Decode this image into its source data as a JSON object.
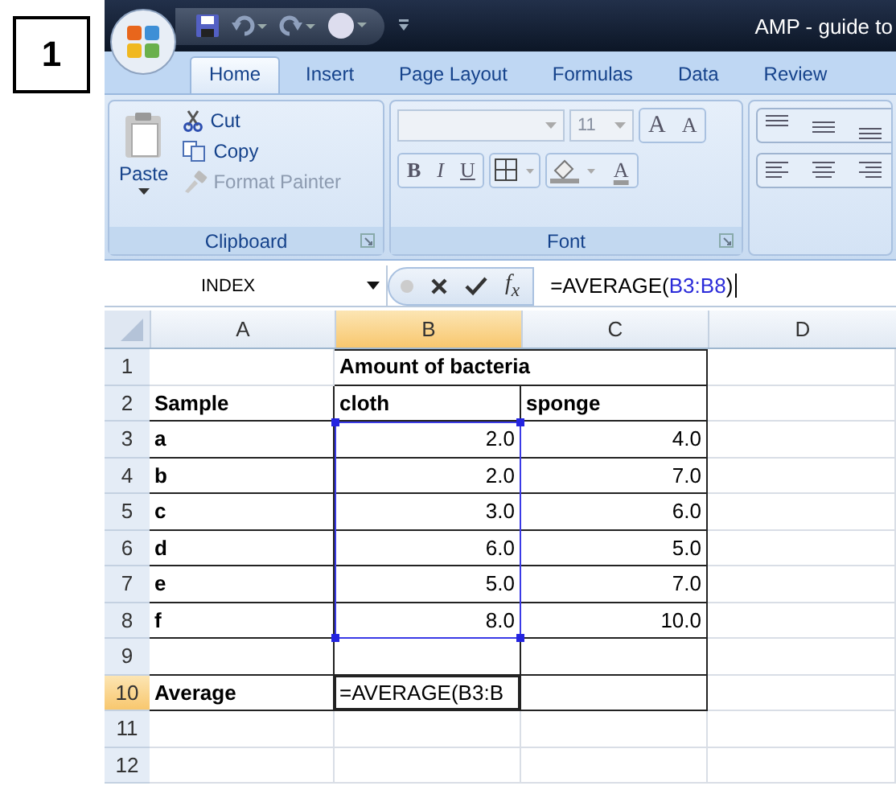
{
  "label": "1",
  "window": {
    "title": "AMP - guide to"
  },
  "tabs": [
    {
      "label": "Home",
      "selected": true
    },
    {
      "label": "Insert",
      "selected": false
    },
    {
      "label": "Page Layout",
      "selected": false
    },
    {
      "label": "Formulas",
      "selected": false
    },
    {
      "label": "Data",
      "selected": false
    },
    {
      "label": "Review",
      "selected": false
    }
  ],
  "ribbon": {
    "clipboard": {
      "title": "Clipboard",
      "paste": "Paste",
      "cut": "Cut",
      "copy": "Copy",
      "format_painter": "Format Painter"
    },
    "font": {
      "title": "Font",
      "size": "11",
      "grow": "A",
      "shrink": "A",
      "bold": "B",
      "italic": "I",
      "underline": "U",
      "font_color": "A"
    }
  },
  "formula_bar": {
    "name_box": "INDEX",
    "fx": "f$_{x}$",
    "formula_start": "=AVERAGE(",
    "formula_ref": "B3:B8",
    "formula_end": ")"
  },
  "sheet": {
    "columns": [
      {
        "label": "A",
        "selected": false
      },
      {
        "label": "B",
        "selected": true
      },
      {
        "label": "C",
        "selected": false
      },
      {
        "label": "D",
        "selected": false
      }
    ],
    "rows": [
      {
        "label": "1",
        "kind": "title",
        "selected": false,
        "in_selection": false,
        "cells": [
          "",
          "Amount of bacteria",
          "",
          ""
        ]
      },
      {
        "label": "2",
        "kind": "header",
        "selected": false,
        "in_selection": false,
        "cells": [
          "Sample",
          "cloth",
          "sponge",
          ""
        ]
      },
      {
        "label": "3",
        "kind": "data",
        "selected": false,
        "in_selection": true,
        "cells": [
          "a",
          "2.0",
          "4.0",
          ""
        ]
      },
      {
        "label": "4",
        "kind": "data",
        "selected": false,
        "in_selection": true,
        "cells": [
          "b",
          "2.0",
          "7.0",
          ""
        ]
      },
      {
        "label": "5",
        "kind": "data",
        "selected": false,
        "in_selection": true,
        "cells": [
          "c",
          "3.0",
          "6.0",
          ""
        ]
      },
      {
        "label": "6",
        "kind": "data",
        "selected": false,
        "in_selection": true,
        "cells": [
          "d",
          "6.0",
          "5.0",
          ""
        ]
      },
      {
        "label": "7",
        "kind": "data",
        "selected": false,
        "in_selection": true,
        "cells": [
          "e",
          "5.0",
          "7.0",
          ""
        ]
      },
      {
        "label": "8",
        "kind": "data",
        "selected": false,
        "in_selection": true,
        "cells": [
          "f",
          "8.0",
          "10.0",
          ""
        ]
      },
      {
        "label": "9",
        "kind": "data",
        "selected": false,
        "in_selection": false,
        "cells": [
          "",
          "",
          "",
          ""
        ]
      },
      {
        "label": "10",
        "kind": "editing",
        "selected": true,
        "in_selection": false,
        "cells": [
          "Average",
          "=AVERAGE(B3:B",
          "",
          ""
        ]
      },
      {
        "label": "11",
        "kind": "blank",
        "selected": false,
        "in_selection": false,
        "cells": [
          "",
          "",
          "",
          ""
        ]
      },
      {
        "label": "12",
        "kind": "blank",
        "selected": false,
        "in_selection": false,
        "cells": [
          "",
          "",
          "",
          ""
        ]
      }
    ]
  }
}
